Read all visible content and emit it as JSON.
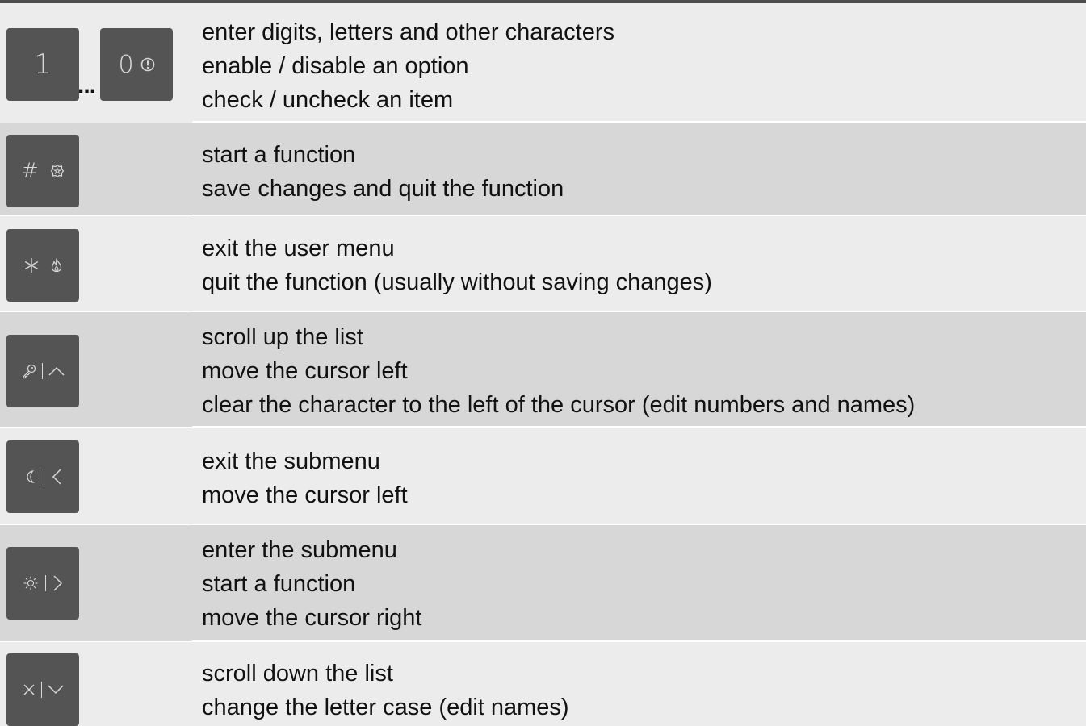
{
  "rows": [
    {
      "keys": [
        {
          "label": "1",
          "icon": "none"
        },
        {
          "label": "0",
          "icon": "exclamation-circle-icon"
        }
      ],
      "ellipsis": "...",
      "lines": [
        "enter digits, letters and other characters",
        "enable / disable an option",
        "check / uncheck an item"
      ]
    },
    {
      "keys": [
        {
          "label": "#",
          "icon": "police-badge-icon"
        }
      ],
      "lines": [
        "start a function",
        "save changes and quit the function"
      ]
    },
    {
      "keys": [
        {
          "label": "*",
          "icon": "flame-icon"
        }
      ],
      "lines": [
        "exit the user menu",
        "quit the function (usually without saving changes)"
      ]
    },
    {
      "keys": [
        {
          "label": "",
          "icon": "key-icon / chevron-up-icon"
        }
      ],
      "lines": [
        "scroll up the list",
        "move the cursor left",
        "clear the character to the left of the cursor (edit numbers and names)"
      ]
    },
    {
      "keys": [
        {
          "label": "",
          "icon": "moon-icon / chevron-left-icon"
        }
      ],
      "lines": [
        "exit the submenu",
        "move the cursor left"
      ]
    },
    {
      "keys": [
        {
          "label": "",
          "icon": "sun-icon / chevron-right-icon"
        }
      ],
      "lines": [
        "enter the submenu",
        "start a function",
        "move the cursor right"
      ]
    },
    {
      "keys": [
        {
          "label": "",
          "icon": "cross-icon / chevron-down-icon"
        }
      ],
      "lines": [
        "scroll down the list",
        "change the letter case (edit names)"
      ]
    }
  ],
  "colors": {
    "row_background": "#ececec",
    "key_background": "#545454",
    "key_glyph": "#d8d8d8",
    "rule": "#4e4e4e"
  }
}
